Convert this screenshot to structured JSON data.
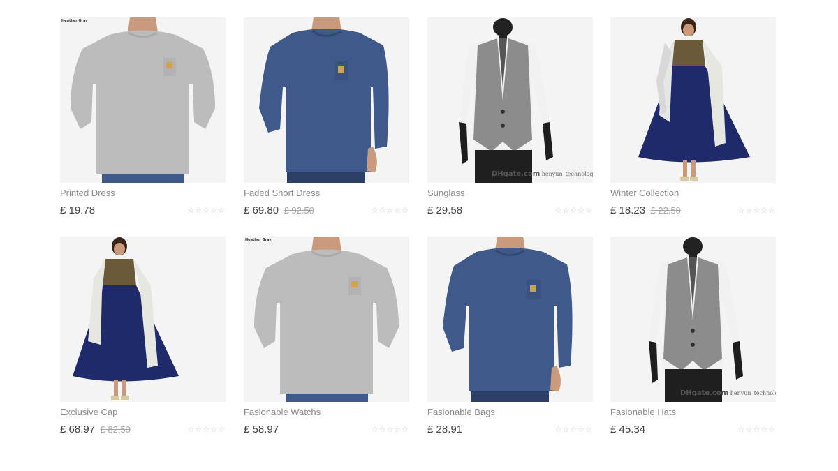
{
  "products": [
    {
      "title": "Printed Dress",
      "price": "£ 19.78",
      "old_price": "",
      "image": "grey-longsleeve-tee",
      "tag": "Heather Gray",
      "watermark": ""
    },
    {
      "title": "Faded Short Dress",
      "price": "£ 69.80",
      "old_price": "£ 92.50",
      "image": "navy-longsleeve-tee",
      "tag": "",
      "watermark": ""
    },
    {
      "title": "Sunglass",
      "price": "£ 29.58",
      "old_price": "",
      "image": "grey-vest-mannequin",
      "tag": "",
      "watermark": "henyun_technology"
    },
    {
      "title": "Winter Collection",
      "price": "£ 18.23",
      "old_price": "£ 22.50",
      "image": "navy-anarkali-dress",
      "tag": "",
      "watermark": ""
    },
    {
      "title": "Exclusive Cap",
      "price": "£ 68.97",
      "old_price": "£ 82.50",
      "image": "navy-anarkali-dress",
      "tag": "",
      "watermark": ""
    },
    {
      "title": "Fasionable Watchs",
      "price": "£ 58.97",
      "old_price": "",
      "image": "grey-longsleeve-tee",
      "tag": "Heather Gray",
      "watermark": ""
    },
    {
      "title": "Fasionable Bags",
      "price": "£ 28.91",
      "old_price": "",
      "image": "navy-longsleeve-tee",
      "tag": "",
      "watermark": ""
    },
    {
      "title": "Fasionable Hats",
      "price": "£ 45.34",
      "old_price": "",
      "image": "grey-vest-mannequin",
      "tag": "",
      "watermark": "henyun_technology"
    }
  ],
  "rating": {
    "stars": "☆☆☆☆☆",
    "value": 0,
    "max": 5
  },
  "watermark_brand": "DHgate.com",
  "colors": {
    "grey_tee": "#bcbcbc",
    "navy": "#3f5a8a",
    "dress_navy": "#1f2a6b",
    "vest": "#8c8c8c",
    "skin": "#c99a7c"
  }
}
